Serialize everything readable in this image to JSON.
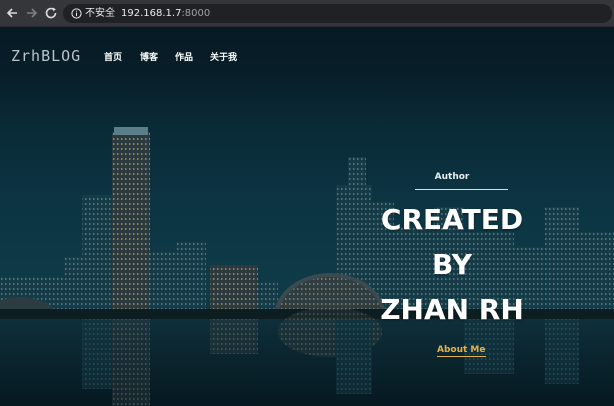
{
  "browser": {
    "security_label": "不安全",
    "separator": "|",
    "url_host": "192.168.1.7",
    "url_port": ":8000"
  },
  "site": {
    "logo": "ZrhBLOG",
    "nav": {
      "home": "首页",
      "blog": "博客",
      "works": "作品",
      "about": "关于我"
    }
  },
  "hero": {
    "author_label": "Author",
    "lines": [
      "CREATED",
      "BY",
      "ZHAN RH"
    ],
    "about_link": "About Me"
  },
  "colors": {
    "accent": "#e1b24c",
    "background": "#0a2b39",
    "text": "#ffffff"
  }
}
